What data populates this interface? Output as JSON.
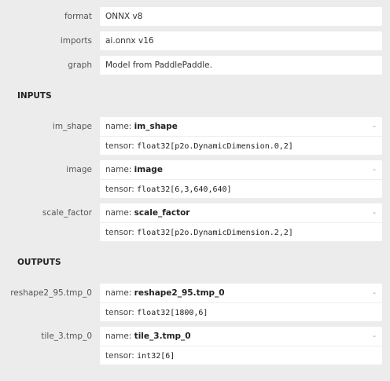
{
  "properties": [
    {
      "label": "format",
      "value": "ONNX v8"
    },
    {
      "label": "imports",
      "value": "ai.onnx v16"
    },
    {
      "label": "graph",
      "value": "Model from PaddlePaddle."
    }
  ],
  "inputs_title": "INPUTS",
  "outputs_title": "OUTPUTS",
  "name_key": "name:",
  "tensor_key": "tensor:",
  "toggle": "-",
  "inputs": [
    {
      "label": "im_shape",
      "name": "im_shape",
      "tensor": "float32[p2o.DynamicDimension.0,2]"
    },
    {
      "label": "image",
      "name": "image",
      "tensor": "float32[6,3,640,640]"
    },
    {
      "label": "scale_factor",
      "name": "scale_factor",
      "tensor": "float32[p2o.DynamicDimension.2,2]"
    }
  ],
  "outputs": [
    {
      "label": "reshape2_95.tmp_0",
      "name": "reshape2_95.tmp_0",
      "tensor": "float32[1800,6]"
    },
    {
      "label": "tile_3.tmp_0",
      "name": "tile_3.tmp_0",
      "tensor": "int32[6]"
    }
  ]
}
